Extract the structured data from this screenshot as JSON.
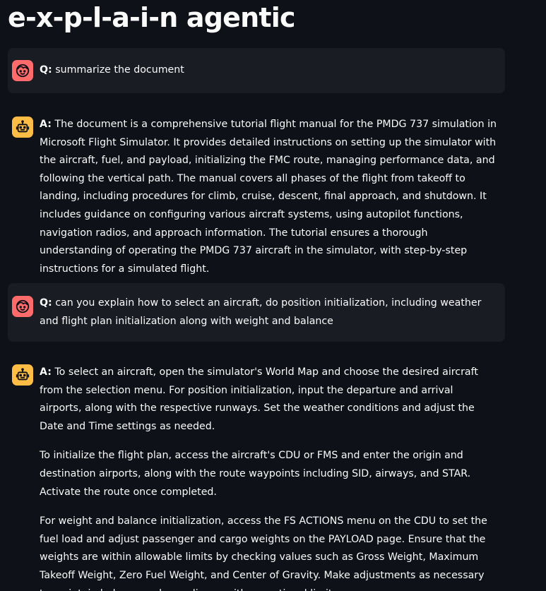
{
  "app": {
    "title": "e-x-p-l-a-i-n agentic"
  },
  "messages": [
    {
      "role": "user",
      "prefix": "Q:",
      "text": " summarize the document",
      "avatar_icon": "user-face-icon",
      "avatar_color": "#ff6b6b"
    },
    {
      "role": "assistant",
      "prefix": "A:",
      "text": " The document is a comprehensive tutorial flight manual for the PMDG 737 simulation in Microsoft Flight Simulator. It provides detailed instructions on setting up the simulator with the aircraft, fuel, and payload, initializing the FMC route, managing performance data, and following the vertical path. The manual covers all phases of the flight from takeoff to landing, including procedures for climb, cruise, descent, final approach, and shutdown. It includes guidance on configuring various aircraft systems, using autopilot functions, navigation radios, and approach information. The tutorial ensures a thorough understanding of operating the PMDG 737 aircraft in the simulator, with step-by-step instructions for a simulated flight.",
      "avatar_icon": "robot-icon",
      "avatar_color": "#ffbd45"
    },
    {
      "role": "user",
      "prefix": "Q:",
      "text": " can you explain how to select an aircraft, do position initialization, including weather and flight plan initialization along with weight and balance",
      "avatar_icon": "user-face-icon",
      "avatar_color": "#ff6b6b"
    },
    {
      "role": "assistant",
      "prefix": "A:",
      "text": " To select an aircraft, open the simulator's World Map and choose the desired aircraft from the selection menu. For position initialization, input the departure and arrival airports, along with the respective runways. Set the weather conditions and adjust the Date and Time settings as needed.",
      "paragraphs": [
        "To initialize the flight plan, access the aircraft's CDU or FMS and enter the origin and destination airports, along with the route waypoints including SID, airways, and STAR. Activate the route once completed.",
        "For weight and balance initialization, access the FS ACTIONS menu on the CDU to set the fuel load and adjust passenger and cargo weights on the PAYLOAD page. Ensure that the weights are within allowable limits by checking values such as Gross Weight, Maximum Takeoff Weight, Zero Fuel Weight, and Center of Gravity. Make adjustments as necessary to maintain balance and compliance with operational limits."
      ],
      "avatar_icon": "robot-icon",
      "avatar_color": "#ffbd45"
    }
  ]
}
